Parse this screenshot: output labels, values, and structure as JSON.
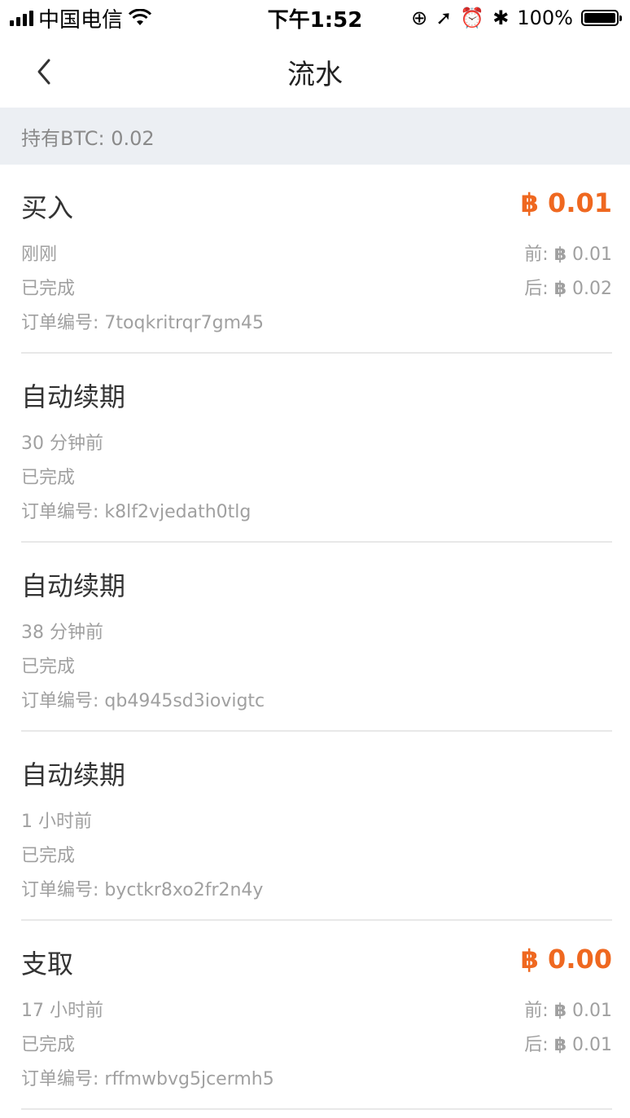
{
  "status_bar": {
    "carrier": "中国电信",
    "time": "下午1:52",
    "battery": "100%"
  },
  "nav": {
    "title": "流水"
  },
  "holding": {
    "text": "持有BTC: 0.02"
  },
  "currency_symbol": "฿",
  "accent_color": "#ef6820",
  "transactions": [
    {
      "type": "买入",
      "amount": "0.01",
      "time": "刚刚",
      "status": "已完成",
      "order": "订单编号: 7toqkritrqr7gm45",
      "before_label": "前:",
      "before": "0.01",
      "after_label": "后:",
      "after": "0.02"
    },
    {
      "type": "自动续期",
      "time": "30 分钟前",
      "status": "已完成",
      "order": "订单编号: k8lf2vjedath0tlg"
    },
    {
      "type": "自动续期",
      "time": "38 分钟前",
      "status": "已完成",
      "order": "订单编号: qb4945sd3iovigtc"
    },
    {
      "type": "自动续期",
      "time": "1 小时前",
      "status": "已完成",
      "order": "订单编号: byctkr8xo2fr2n4y"
    },
    {
      "type": "支取",
      "amount": "0.00",
      "time": "17 小时前",
      "status": "已完成",
      "order": "订单编号: rffmwbvg5jcermh5",
      "before_label": "前:",
      "before": "0.01",
      "after_label": "后:",
      "after": "0.01"
    }
  ]
}
